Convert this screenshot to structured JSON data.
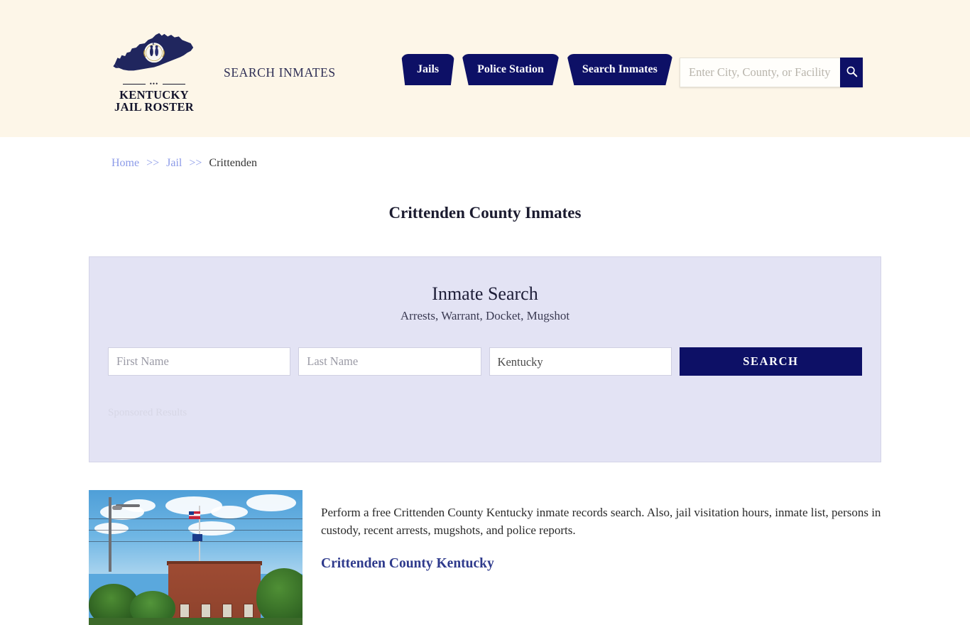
{
  "header": {
    "logo": {
      "line1": "KENTUCKY",
      "line2": "JAIL ROSTER",
      "map_icon": "kentucky-state-map-icon",
      "seal_icon": "kentucky-state-seal-icon",
      "divider_dots": "•••"
    },
    "tagline": "SEARCH INMATES",
    "nav": [
      {
        "label": "Jails"
      },
      {
        "label": "Police Station"
      },
      {
        "label": "Search Inmates"
      }
    ],
    "search": {
      "placeholder": "Enter City, County, or Facility",
      "value": "",
      "button_icon": "search-icon"
    }
  },
  "breadcrumb": {
    "items": [
      {
        "label": "Home",
        "type": "link"
      },
      {
        "label": "Jail",
        "type": "link"
      },
      {
        "label": "Crittenden",
        "type": "current"
      }
    ],
    "separator": ">>"
  },
  "page": {
    "title": "Crittenden County Inmates"
  },
  "search_panel": {
    "title": "Inmate Search",
    "subtitle": "Arrests, Warrant, Docket, Mugshot",
    "first_name_placeholder": "First Name",
    "first_name_value": "",
    "last_name_placeholder": "Last Name",
    "last_name_value": "",
    "state_selected": "Kentucky",
    "state_options": [
      "Kentucky"
    ],
    "search_button": "SEARCH",
    "sponsored_label": "Sponsored Results"
  },
  "content": {
    "image_alt": "crittenden-county-courthouse-photo",
    "paragraph": "Perform a free Crittenden County Kentucky inmate records search. Also, jail visitation hours, inmate list, persons in custody, recent arrests, mugshots, and police reports.",
    "subheading": "Crittenden County Kentucky"
  },
  "colors": {
    "header_bg": "#fdf6e8",
    "navy": "#0d1066",
    "panel_bg": "#e3e3f4",
    "link": "#8b9ae8",
    "subhead": "#2e3a8c"
  }
}
